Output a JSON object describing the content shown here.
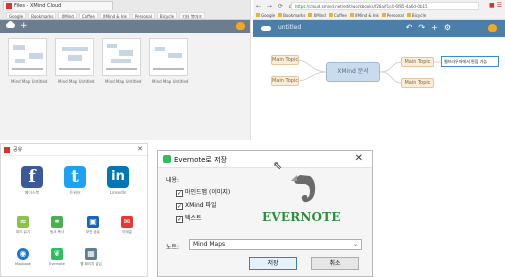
{
  "panel_a": {
    "tab_title": "Files - XMind Cloud",
    "bookmarks": [
      "Google",
      "Bookmarks",
      "XMind",
      "Coffee",
      "XMind & Ink",
      "Personal",
      "Bicycle",
      "기타 북마크"
    ],
    "files": [
      {
        "caption": "Mind Map Untitled"
      },
      {
        "caption": "Mind Map Untitled"
      },
      {
        "caption": "Mind Map Untitled"
      },
      {
        "caption": "Mind Map Untitled"
      }
    ]
  },
  "panel_b": {
    "url_secure": "https://",
    "url_rest": "cloud.xmind.net/edit/workbooks/f28a/f1c4-6f85-4a6d-0b15",
    "bookmarks": [
      "Google",
      "Bookmarks",
      "XMind",
      "Coffee",
      "XMind & Ink",
      "Personal",
      "Bicycle"
    ],
    "doc_title": "untitled",
    "central_topic": "XMind 문서",
    "main_topic": "Main Topic",
    "editing_topic": "웹브라우저에서 편집 가능"
  },
  "panel_c": {
    "title": "공유",
    "close": "✕",
    "social": [
      {
        "glyph": "f",
        "label": "페이스북",
        "color": "#3b5998"
      },
      {
        "glyph": "t",
        "label": "트위터",
        "color": "#1da1f2"
      },
      {
        "glyph": "in",
        "label": "LinkedIn",
        "color": "#0077b5"
      }
    ],
    "actions_row1": [
      {
        "glyph": "≈",
        "label": "피드 읽기",
        "color": "#8bc34a"
      },
      {
        "glyph": "⚭",
        "label": "링크 복사",
        "color": "#4caf50"
      },
      {
        "glyph": "▣",
        "label": "보안 공유",
        "color": "#1565c0"
      },
      {
        "glyph": "✉",
        "label": "이메일",
        "color": "#e53935"
      }
    ],
    "actions_row2": [
      {
        "glyph": "◉",
        "label": "Mapbook",
        "color": "#1976d2"
      },
      {
        "glyph": "❦",
        "label": "Evernote",
        "color": "#2dbe60"
      },
      {
        "glyph": "▦",
        "label": "웹 페이지 삽입",
        "color": "#607d8b"
      }
    ]
  },
  "panel_d": {
    "title": "Evernote로 저장",
    "close": "✕",
    "section_label": "내용:",
    "options": [
      {
        "label": "마인드맵 (이미지)",
        "checked": true
      },
      {
        "label": "XMind 파일",
        "checked": true
      },
      {
        "label": "텍스트",
        "checked": true
      }
    ],
    "wordmark": "EVERNOTE",
    "notebook_label": "노트:",
    "notebook_value": "Mind Maps",
    "save_button": "저장",
    "cancel_button": "취소",
    "accent": "#2dbe60"
  }
}
